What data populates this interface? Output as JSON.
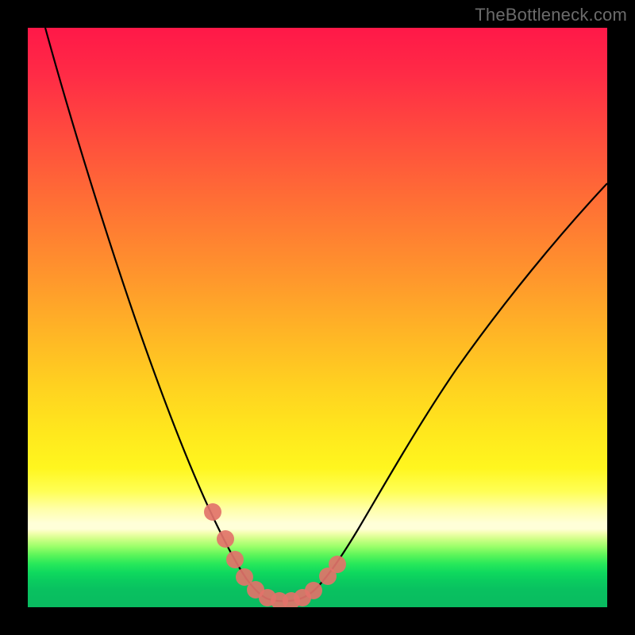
{
  "watermark": "TheBottleneck.com",
  "chart_data": {
    "type": "line",
    "title": "",
    "xlabel": "",
    "ylabel": "",
    "xlim": [
      0,
      100
    ],
    "ylim": [
      0,
      100
    ],
    "grid": false,
    "legend": false,
    "series": [
      {
        "name": "bottleneck-curve",
        "color": "#000000",
        "x": [
          3,
          6,
          9,
          12,
          15,
          18,
          21,
          24,
          26,
          28,
          30,
          31.5,
          33,
          34.5,
          36,
          37.5,
          39,
          41,
          43,
          45,
          47,
          50,
          54,
          58,
          62,
          66,
          70,
          75,
          80,
          85,
          90,
          95,
          100
        ],
        "y": [
          100,
          93,
          86,
          78,
          70,
          62,
          54,
          46,
          39,
          32,
          25,
          20,
          15,
          11,
          8,
          5.5,
          3.5,
          2,
          1.2,
          1,
          1.2,
          2,
          4,
          7.5,
          12,
          17.5,
          24,
          32,
          41,
          50,
          59,
          68,
          76
        ]
      },
      {
        "name": "highlight-markers",
        "color": "#e2736a",
        "type": "scatter",
        "x": [
          31.5,
          33.2,
          34.8,
          36.5,
          38.5,
          40.5,
          42.5,
          44.5,
          46.5
        ],
        "y": [
          20,
          13,
          8.5,
          5,
          2.8,
          1.6,
          1.2,
          1.2,
          1.8
        ]
      }
    ],
    "background_gradient": {
      "top": "#ff1848",
      "mid": "#ffd61e",
      "lower": "#ffffb0",
      "bottom": "#09bb60"
    }
  },
  "colors": {
    "frame": "#000000",
    "curve": "#000000",
    "marker": "#e2736a",
    "watermark": "#6b6b6b"
  }
}
